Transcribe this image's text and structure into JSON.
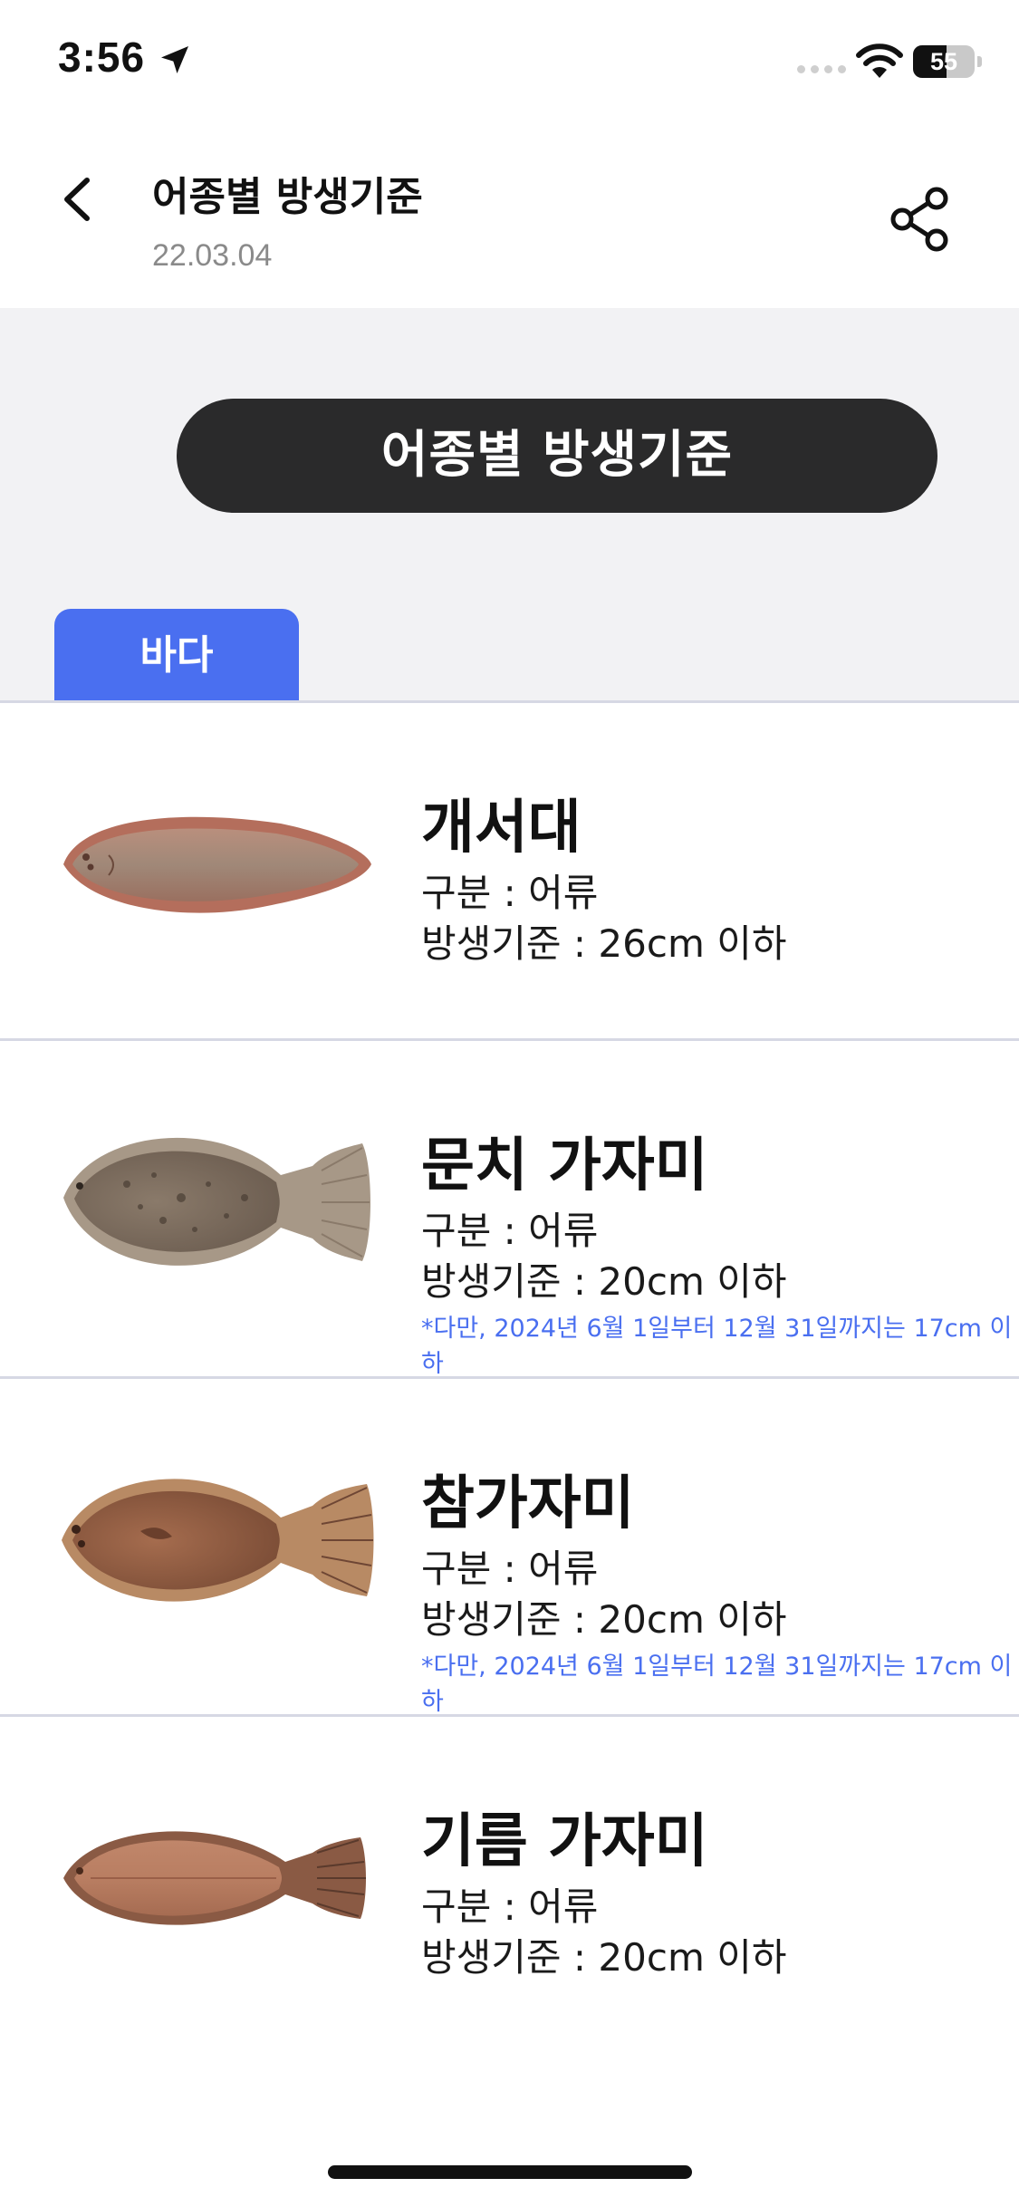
{
  "status_bar": {
    "time": "3:56",
    "battery_level": "55",
    "icons": [
      "location-arrow-icon",
      "signal-icon",
      "wifi-icon",
      "battery-icon"
    ]
  },
  "header": {
    "title": "어종별 방생기준",
    "date": "22.03.04",
    "back_icon": "chevron-left-icon",
    "share_icon": "share-icon"
  },
  "banner": {
    "title": "어종별 방생기준"
  },
  "tabs": [
    {
      "label": "바다",
      "active": true
    }
  ],
  "colors": {
    "accent": "#4a6ff0",
    "banner_bg": "#2a2a2b",
    "section_bg": "#f2f2f4",
    "divider": "#d6d8e4"
  },
  "fish": [
    {
      "name": "개서대",
      "category": "구분 : 어류",
      "standard": "방생기준 : 26cm 이하",
      "note": "",
      "image": "tonguefish-image"
    },
    {
      "name": "문치 가자미",
      "category": "구분 : 어류",
      "standard": "방생기준 : 20cm 이하",
      "note": "*다만, 2024년 6월 1일부터 12월 31일까지는 17cm 이하",
      "image": "marbled-flounder-image"
    },
    {
      "name": "참가자미",
      "category": "구분 : 어류",
      "standard": "방생기준 : 20cm 이하",
      "note": "*다만, 2024년 6월 1일부터 12월 31일까지는 17cm 이하",
      "image": "brown-sole-image"
    },
    {
      "name": "기름 가자미",
      "category": "구분 : 어류",
      "standard": "방생기준 : 20cm 이하",
      "note": "",
      "image": "slime-flounder-image"
    }
  ]
}
